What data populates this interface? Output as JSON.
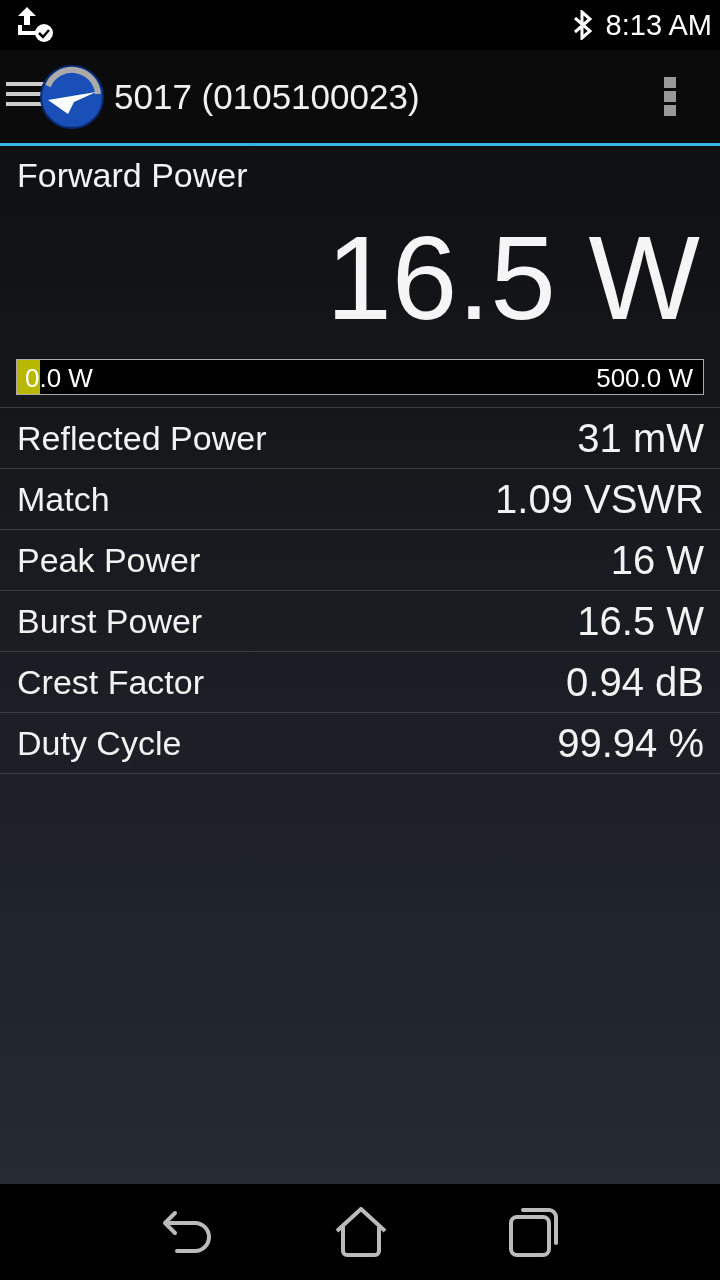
{
  "status_bar": {
    "time": "8:13 AM"
  },
  "app_bar": {
    "title": "5017 (0105100023)"
  },
  "main_reading": {
    "label": "Forward Power",
    "value": "16.5 W",
    "meter": {
      "level": 0.033,
      "min_label": "0.0 W",
      "max_label": "500.0 W"
    }
  },
  "measurements": [
    {
      "label": "Reflected Power",
      "value": "31 mW"
    },
    {
      "label": "Match",
      "value": "1.09 VSWR"
    },
    {
      "label": "Peak Power",
      "value": "16 W"
    },
    {
      "label": "Burst Power",
      "value": "16.5 W"
    },
    {
      "label": "Crest Factor",
      "value": "0.94 dB"
    },
    {
      "label": "Duty Cycle",
      "value": "99.94 %"
    }
  ]
}
